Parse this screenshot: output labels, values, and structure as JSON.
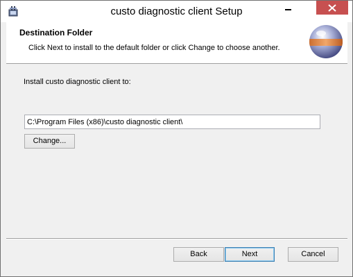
{
  "window": {
    "title": "custo diagnostic client Setup",
    "app_icon": "installer-icon",
    "minimize_icon": "minimize-icon",
    "close_icon": "close-icon"
  },
  "header": {
    "title": "Destination Folder",
    "description": "Click Next to install to the default folder or click Change to choose another.",
    "logo_icon": "installer-sphere-icon"
  },
  "main": {
    "install_label": "Install custo diagnostic client to:",
    "install_path": "C:\\Program Files (x86)\\custo diagnostic client\\",
    "change_label": "Change..."
  },
  "footer": {
    "back_label": "Back",
    "next_label": "Next",
    "cancel_label": "Cancel"
  },
  "colors": {
    "close_button": "#c75050",
    "dialog_background": "#f0f0f0",
    "header_background": "#ffffff",
    "default_button_border": "#3c7fb1"
  }
}
